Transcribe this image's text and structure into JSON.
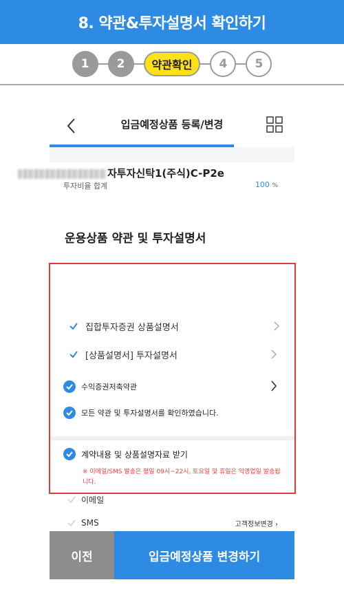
{
  "header": {
    "title": "8. 약관&투자설명서 확인하기"
  },
  "steps": [
    {
      "label": "1",
      "state": "done"
    },
    {
      "label": "2",
      "state": "done"
    },
    {
      "label": "약관확인",
      "state": "current"
    },
    {
      "label": "4",
      "state": "todo"
    },
    {
      "label": "5",
      "state": "todo"
    }
  ],
  "nav": {
    "title": "입금예정상품 등록/변경",
    "back_icon": "chevron-left-icon",
    "menu_icon": "grid-icon"
  },
  "ratio": {
    "label": "투자비율 합계",
    "value": "100",
    "unit": "%"
  },
  "section": {
    "title": "운용상품 약관 및 투자설명서",
    "product_name": "자투자신탁1(주식)C-P2e",
    "docs": [
      {
        "label": "집합투자증권 상품설명서"
      },
      {
        "label": "[상품설명서] 투자설명서"
      }
    ],
    "agreements": [
      {
        "label": "수익증권저축약관",
        "checked": true
      },
      {
        "label": "모든 약관 및 투자설명서를 확인하였습니다.",
        "checked": true
      }
    ],
    "receive": {
      "label": "계약내용 및 상품설명자료 받기",
      "checked": true,
      "notice": "※ 이메일/SMS 발송은 평일 09시~22시, 토요일 및 휴일은 익영업일 발송됩니다."
    },
    "options": [
      {
        "label": "이메일",
        "right": ""
      },
      {
        "label": "SMS",
        "right": "고객정보변경 ›"
      }
    ]
  },
  "buttons": {
    "prev": "이전",
    "next": "입금예정상품 변경하기"
  },
  "colors": {
    "brand": "#2d8be4",
    "current_step": "#ffe119",
    "highlight": "#e23a3a",
    "notice": "#e8413a"
  }
}
